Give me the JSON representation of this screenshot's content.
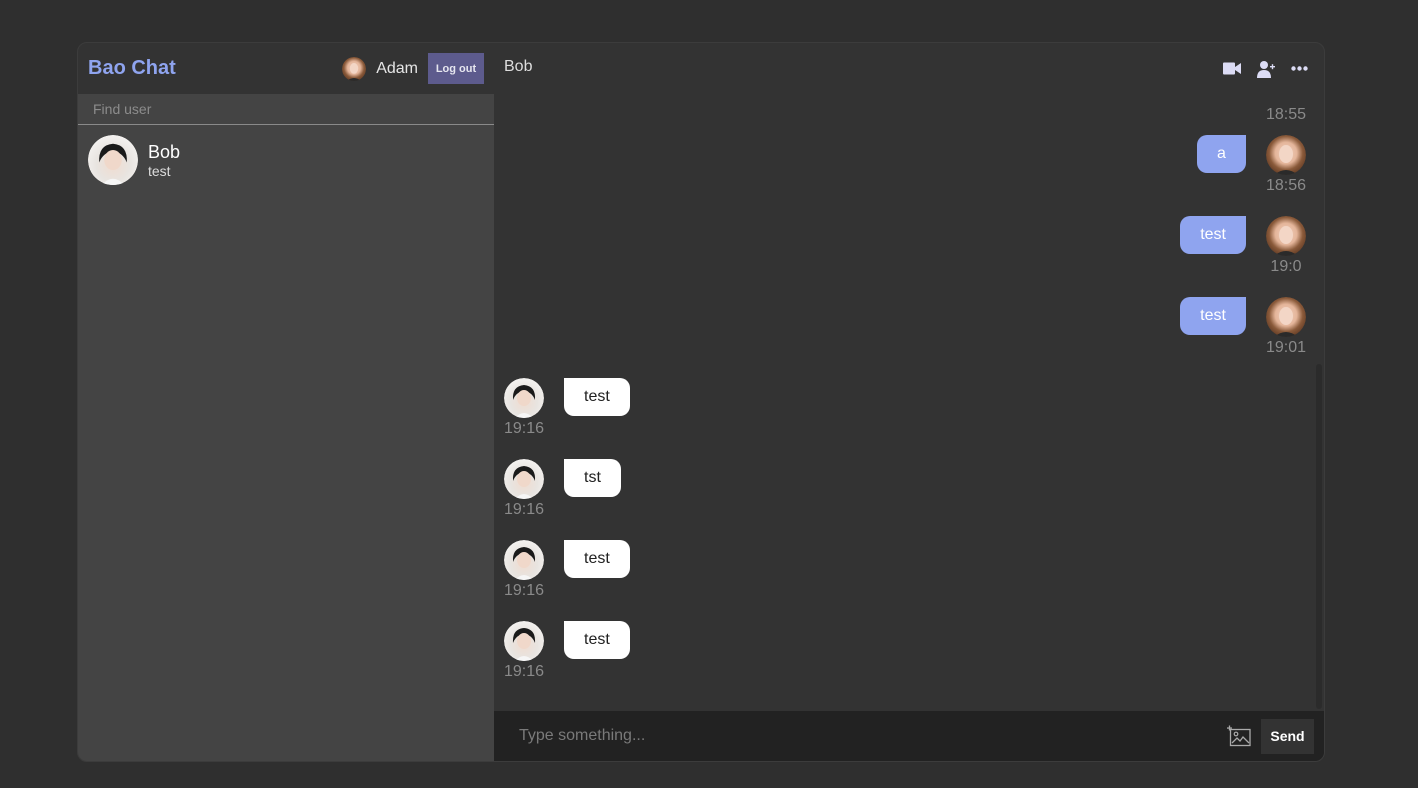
{
  "app": {
    "brand": "Bao Chat",
    "current_user": {
      "name": "Adam",
      "avatar": "adam-avatar"
    },
    "logout_label": "Log out",
    "accent_color": "#8fa4ef"
  },
  "sidebar": {
    "search_placeholder": "Find user",
    "contacts": [
      {
        "name": "Bob",
        "last_message": "test",
        "avatar": "bob-avatar"
      }
    ]
  },
  "chat": {
    "title": "Bob",
    "header_icons": [
      "video-camera-icon",
      "add-user-icon",
      "more-icon"
    ],
    "messages": [
      {
        "sender": "Adam",
        "own": true,
        "text": "",
        "time": "18:55"
      },
      {
        "sender": "Adam",
        "own": true,
        "text": "a",
        "time": "18:56"
      },
      {
        "sender": "Adam",
        "own": true,
        "text": "test",
        "time": "19:0"
      },
      {
        "sender": "Adam",
        "own": true,
        "text": "test",
        "time": "19:01"
      },
      {
        "sender": "Bob",
        "own": false,
        "text": "test",
        "time": "19:16"
      },
      {
        "sender": "Bob",
        "own": false,
        "text": "tst",
        "time": "19:16"
      },
      {
        "sender": "Bob",
        "own": false,
        "text": "test",
        "time": "19:16"
      },
      {
        "sender": "Bob",
        "own": false,
        "text": "test",
        "time": "19:16"
      }
    ],
    "composer": {
      "placeholder": "Type something...",
      "value": "",
      "send_label": "Send",
      "attach_icon": "add-image-icon"
    }
  }
}
